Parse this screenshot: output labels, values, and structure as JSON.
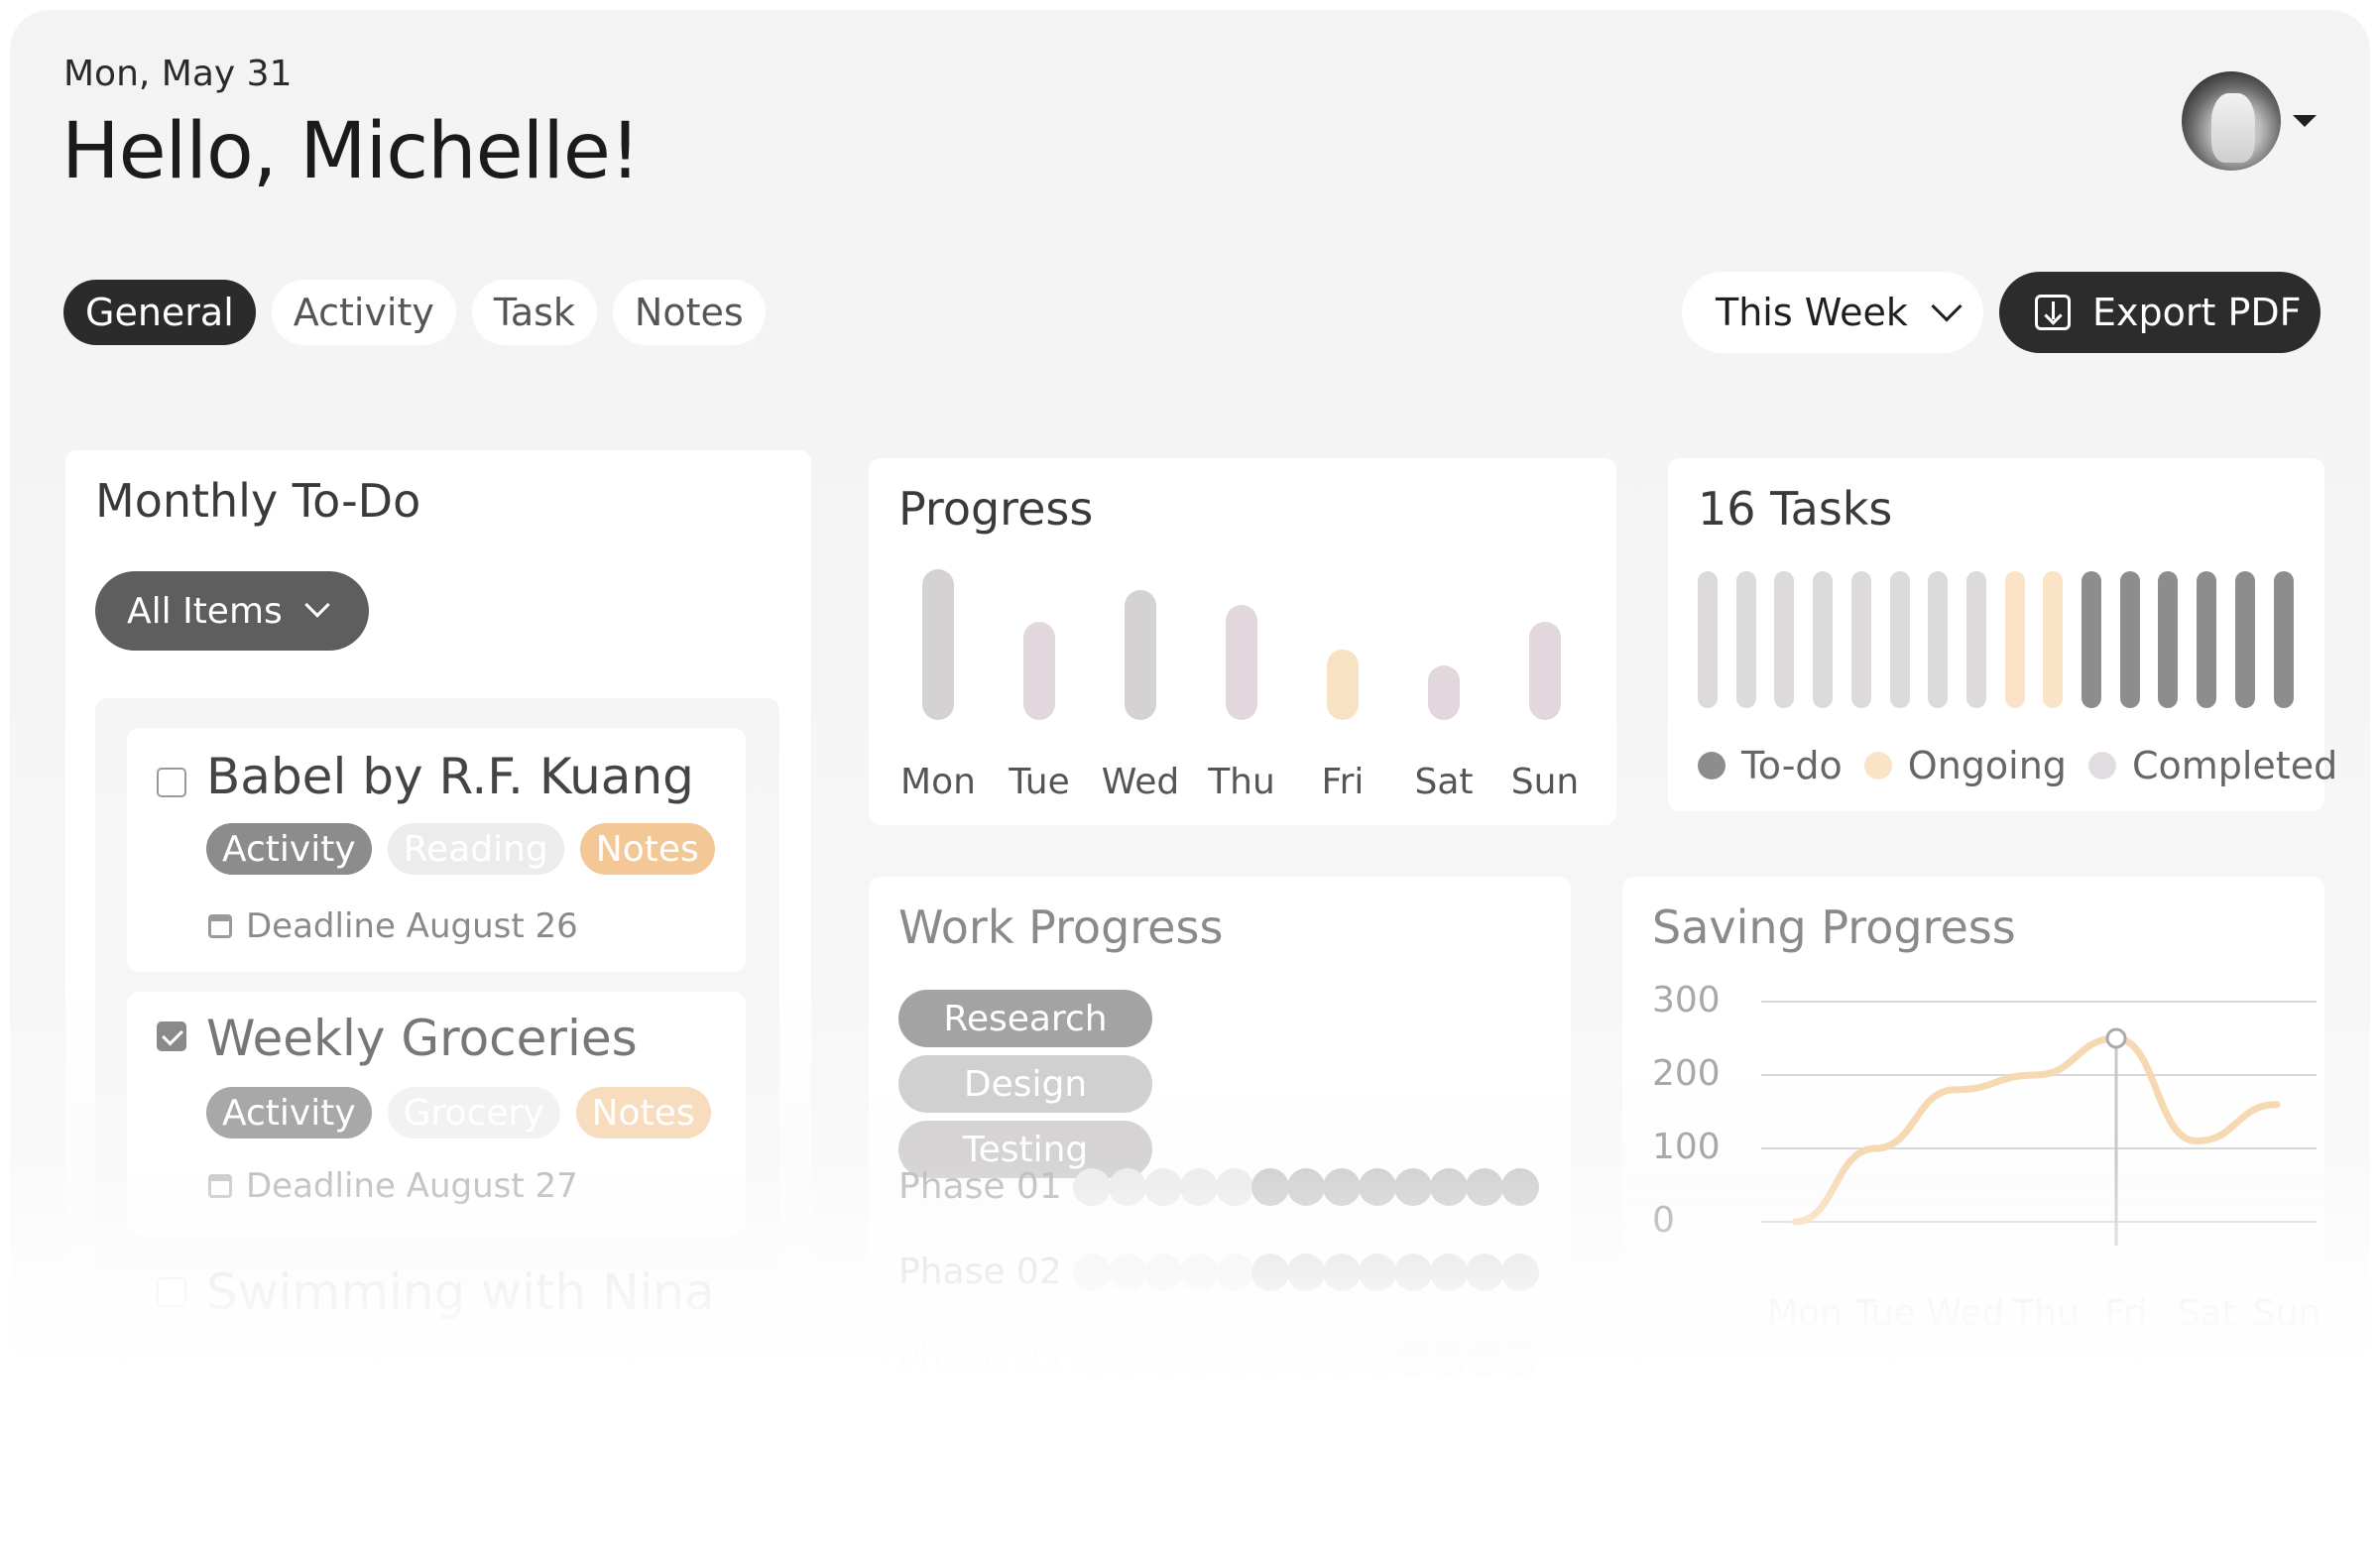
{
  "header": {
    "date": "Mon, May 31",
    "greeting": "Hello, Michelle!"
  },
  "tabs": [
    {
      "label": "General",
      "active": true
    },
    {
      "label": "Activity",
      "active": false
    },
    {
      "label": "Task",
      "active": false
    },
    {
      "label": "Notes",
      "active": false
    }
  ],
  "toolbar": {
    "period_label": "This Week",
    "export_label": "Export PDF"
  },
  "todo": {
    "title": "Monthly To-Do",
    "filter_label": "All Items",
    "items": [
      {
        "name": "Babel by R.F. Kuang",
        "checked": false,
        "tags": [
          "Activity",
          "Reading",
          "Notes"
        ],
        "deadline": "Deadline August 26"
      },
      {
        "name": "Weekly Groceries",
        "checked": true,
        "tags": [
          "Activity",
          "Grocery",
          "Notes"
        ],
        "deadline": "Deadline August 27"
      },
      {
        "name": "Swimming with Nina",
        "checked": false
      }
    ]
  },
  "progress": {
    "title": "Progress",
    "days": [
      "Mon",
      "Tue",
      "Wed",
      "Thu",
      "Fri",
      "Sat",
      "Sun"
    ],
    "levels": [
      1.0,
      0.65,
      0.86,
      0.76,
      0.47,
      0.36,
      0.65
    ],
    "colors": [
      "#d4d2d3",
      "#e2d7dd",
      "#d4d2d3",
      "#e2d7dd",
      "#f8e2c4",
      "#e2d7dd",
      "#e2d7dd"
    ]
  },
  "tasks": {
    "title": "16 Tasks",
    "counts": {
      "todo": 6,
      "ongoing": 2,
      "completed": 8
    },
    "bar_states": [
      "completed",
      "completed",
      "completed",
      "completed",
      "completed",
      "completed",
      "completed",
      "completed",
      "ongoing",
      "ongoing",
      "todo",
      "todo",
      "todo",
      "todo",
      "todo",
      "todo"
    ],
    "legend": [
      {
        "label": "To-do",
        "color": "#8d8d8d"
      },
      {
        "label": "Ongoing",
        "color": "#fae3c6"
      },
      {
        "label": "Completed",
        "color": "#e2dde0"
      }
    ]
  },
  "work": {
    "title": "Work Progress",
    "chips": [
      {
        "label": "Research",
        "color": "#a3a3a3"
      },
      {
        "label": "Design",
        "color": "#d0d0d0"
      },
      {
        "label": "Testing",
        "color": "#d6d3d5"
      }
    ],
    "phases": [
      {
        "label": "Phase 01",
        "done": 8,
        "total": 13
      },
      {
        "label": "Phase 02",
        "done": 8,
        "total": 13
      },
      {
        "label": "Phase 03",
        "done": 4,
        "total": 13
      }
    ]
  },
  "saving": {
    "title": "Saving Progress",
    "chart_data": {
      "type": "line",
      "title": "Saving Progress",
      "x": [
        "Mon",
        "Tue",
        "Wed",
        "Thu",
        "Fri",
        "Sat",
        "Sun"
      ],
      "series": [
        {
          "values": [
            0,
            100,
            180,
            200,
            250,
            110,
            160
          ]
        }
      ],
      "yticks": [
        300,
        200,
        100,
        0
      ],
      "ylim": [
        0,
        300
      ],
      "highlight_index": 4,
      "grid": true,
      "line_color": "#f6d9b3"
    }
  }
}
